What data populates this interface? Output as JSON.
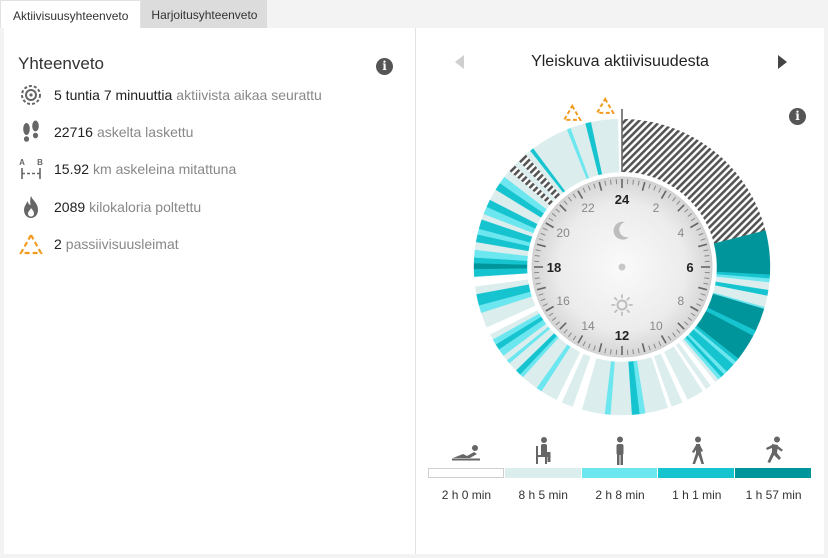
{
  "tabs": [
    {
      "label": "Aktiivisuusyhteenveto",
      "active": true
    },
    {
      "label": "Harjoitusyhteenveto",
      "active": false
    }
  ],
  "summary": {
    "title": "Yhteenveto",
    "info_icon": "i",
    "stats": [
      {
        "icon": "activity-timer-icon",
        "value": "5 tuntia 7 minuuttia",
        "label": "aktiivista aikaa seurattu"
      },
      {
        "icon": "footprints-icon",
        "value": "22716",
        "label": "askelta laskettu"
      },
      {
        "icon": "distance-icon",
        "value": "15.92",
        "label": "km askeleina mitattuna",
        "icon_letters": [
          "A",
          "B"
        ]
      },
      {
        "icon": "flame-icon",
        "value": "2089",
        "label": "kilokaloria poltettu"
      },
      {
        "icon": "inactivity-stamp-icon",
        "value": "2",
        "label": "passiivisuusleimat"
      }
    ]
  },
  "overview": {
    "title": "Yleiskuva aktiivisuudesta",
    "info_icon": "i",
    "clock_labels_bold": [
      "24",
      "6",
      "12",
      "18"
    ],
    "clock_labels_small": [
      "2",
      "4",
      "8",
      "10",
      "14",
      "16",
      "20",
      "22"
    ],
    "passive_stamps": [
      22.8,
      23.6
    ],
    "colors": {
      "unmeasured": "#555555",
      "rest": "#ffffff",
      "sitting": "#dbeded",
      "standing": "#6ce6ef",
      "walking": "#16c4d0",
      "running": "#00959b",
      "stamp": "#f39b1f"
    },
    "segments": [
      [
        0.0,
        5.05,
        "unmeasured"
      ],
      [
        5.05,
        6.2,
        "running"
      ],
      [
        6.2,
        6.3,
        "walking"
      ],
      [
        6.3,
        6.4,
        "standing"
      ],
      [
        6.4,
        6.6,
        "sitting"
      ],
      [
        6.6,
        6.75,
        "walking"
      ],
      [
        6.75,
        7.05,
        "sitting"
      ],
      [
        7.05,
        7.1,
        "standing"
      ],
      [
        7.1,
        7.7,
        "running"
      ],
      [
        7.7,
        7.85,
        "walking"
      ],
      [
        7.85,
        8.55,
        "running"
      ],
      [
        8.55,
        8.65,
        "walking"
      ],
      [
        8.65,
        8.75,
        "standing"
      ],
      [
        8.75,
        9.0,
        "walking"
      ],
      [
        9.0,
        9.1,
        "standing"
      ],
      [
        9.1,
        9.2,
        "walking"
      ],
      [
        9.2,
        9.3,
        "standing"
      ],
      [
        9.3,
        9.4,
        "sitting"
      ],
      [
        9.4,
        9.55,
        "rest"
      ],
      [
        9.55,
        9.7,
        "sitting"
      ],
      [
        9.7,
        9.8,
        "rest"
      ],
      [
        9.8,
        10.25,
        "sitting"
      ],
      [
        10.25,
        10.4,
        "rest"
      ],
      [
        10.4,
        10.7,
        "sitting"
      ],
      [
        10.7,
        10.8,
        "rest"
      ],
      [
        10.8,
        11.4,
        "sitting"
      ],
      [
        11.4,
        11.55,
        "standing"
      ],
      [
        11.55,
        11.75,
        "walking"
      ],
      [
        11.75,
        12.3,
        "sitting"
      ],
      [
        12.3,
        12.45,
        "standing"
      ],
      [
        12.45,
        13.05,
        "sitting"
      ],
      [
        13.05,
        13.3,
        "rest"
      ],
      [
        13.3,
        13.6,
        "sitting"
      ],
      [
        13.6,
        13.75,
        "rest"
      ],
      [
        13.75,
        14.2,
        "sitting"
      ],
      [
        14.2,
        14.35,
        "standing"
      ],
      [
        14.35,
        14.8,
        "sitting"
      ],
      [
        14.8,
        14.9,
        "standing"
      ],
      [
        14.9,
        15.05,
        "walking"
      ],
      [
        15.05,
        15.3,
        "sitting"
      ],
      [
        15.3,
        15.4,
        "standing"
      ],
      [
        15.4,
        15.55,
        "sitting"
      ],
      [
        15.55,
        15.75,
        "standing"
      ],
      [
        15.75,
        15.9,
        "walking"
      ],
      [
        15.9,
        16.05,
        "standing"
      ],
      [
        16.05,
        16.2,
        "sitting"
      ],
      [
        16.2,
        16.4,
        "rest"
      ],
      [
        16.4,
        16.8,
        "sitting"
      ],
      [
        16.8,
        17.0,
        "standing"
      ],
      [
        17.0,
        17.3,
        "walking"
      ],
      [
        17.3,
        17.5,
        "sitting"
      ],
      [
        17.5,
        17.75,
        "rest"
      ],
      [
        17.75,
        17.95,
        "walking"
      ],
      [
        17.95,
        18.1,
        "running"
      ],
      [
        18.1,
        18.25,
        "walking"
      ],
      [
        18.25,
        18.45,
        "standing"
      ],
      [
        18.45,
        18.65,
        "sitting"
      ],
      [
        18.65,
        18.85,
        "walking"
      ],
      [
        18.85,
        19.0,
        "standing"
      ],
      [
        19.0,
        19.25,
        "walking"
      ],
      [
        19.25,
        19.4,
        "sitting"
      ],
      [
        19.4,
        19.6,
        "standing"
      ],
      [
        19.6,
        19.8,
        "walking"
      ],
      [
        19.8,
        20.1,
        "sitting"
      ],
      [
        20.1,
        20.3,
        "walking"
      ],
      [
        20.3,
        20.5,
        "standing"
      ],
      [
        20.5,
        20.7,
        "sitting"
      ],
      [
        20.7,
        20.9,
        "unmeasured"
      ],
      [
        20.9,
        21.05,
        "sitting"
      ],
      [
        21.05,
        21.3,
        "unmeasured"
      ],
      [
        21.3,
        21.45,
        "sitting"
      ],
      [
        21.45,
        21.55,
        "walking"
      ],
      [
        21.55,
        22.55,
        "sitting"
      ],
      [
        22.55,
        22.65,
        "standing"
      ],
      [
        22.65,
        23.05,
        "sitting"
      ],
      [
        23.05,
        23.2,
        "walking"
      ],
      [
        23.2,
        23.9,
        "sitting"
      ],
      [
        23.9,
        24.0,
        "rest"
      ]
    ]
  },
  "legend": [
    {
      "icon": "lying-icon",
      "color": "#ffffff",
      "value": "2 h 0 min"
    },
    {
      "icon": "sitting-icon",
      "color": "#dbeded",
      "value": "8 h 5 min"
    },
    {
      "icon": "standing-icon",
      "color": "#6ce6ef",
      "value": "2 h 8 min"
    },
    {
      "icon": "walking-icon",
      "color": "#16c4d0",
      "value": "1 h 1 min"
    },
    {
      "icon": "running-icon",
      "color": "#00959b",
      "value": "1 h 57 min"
    }
  ]
}
